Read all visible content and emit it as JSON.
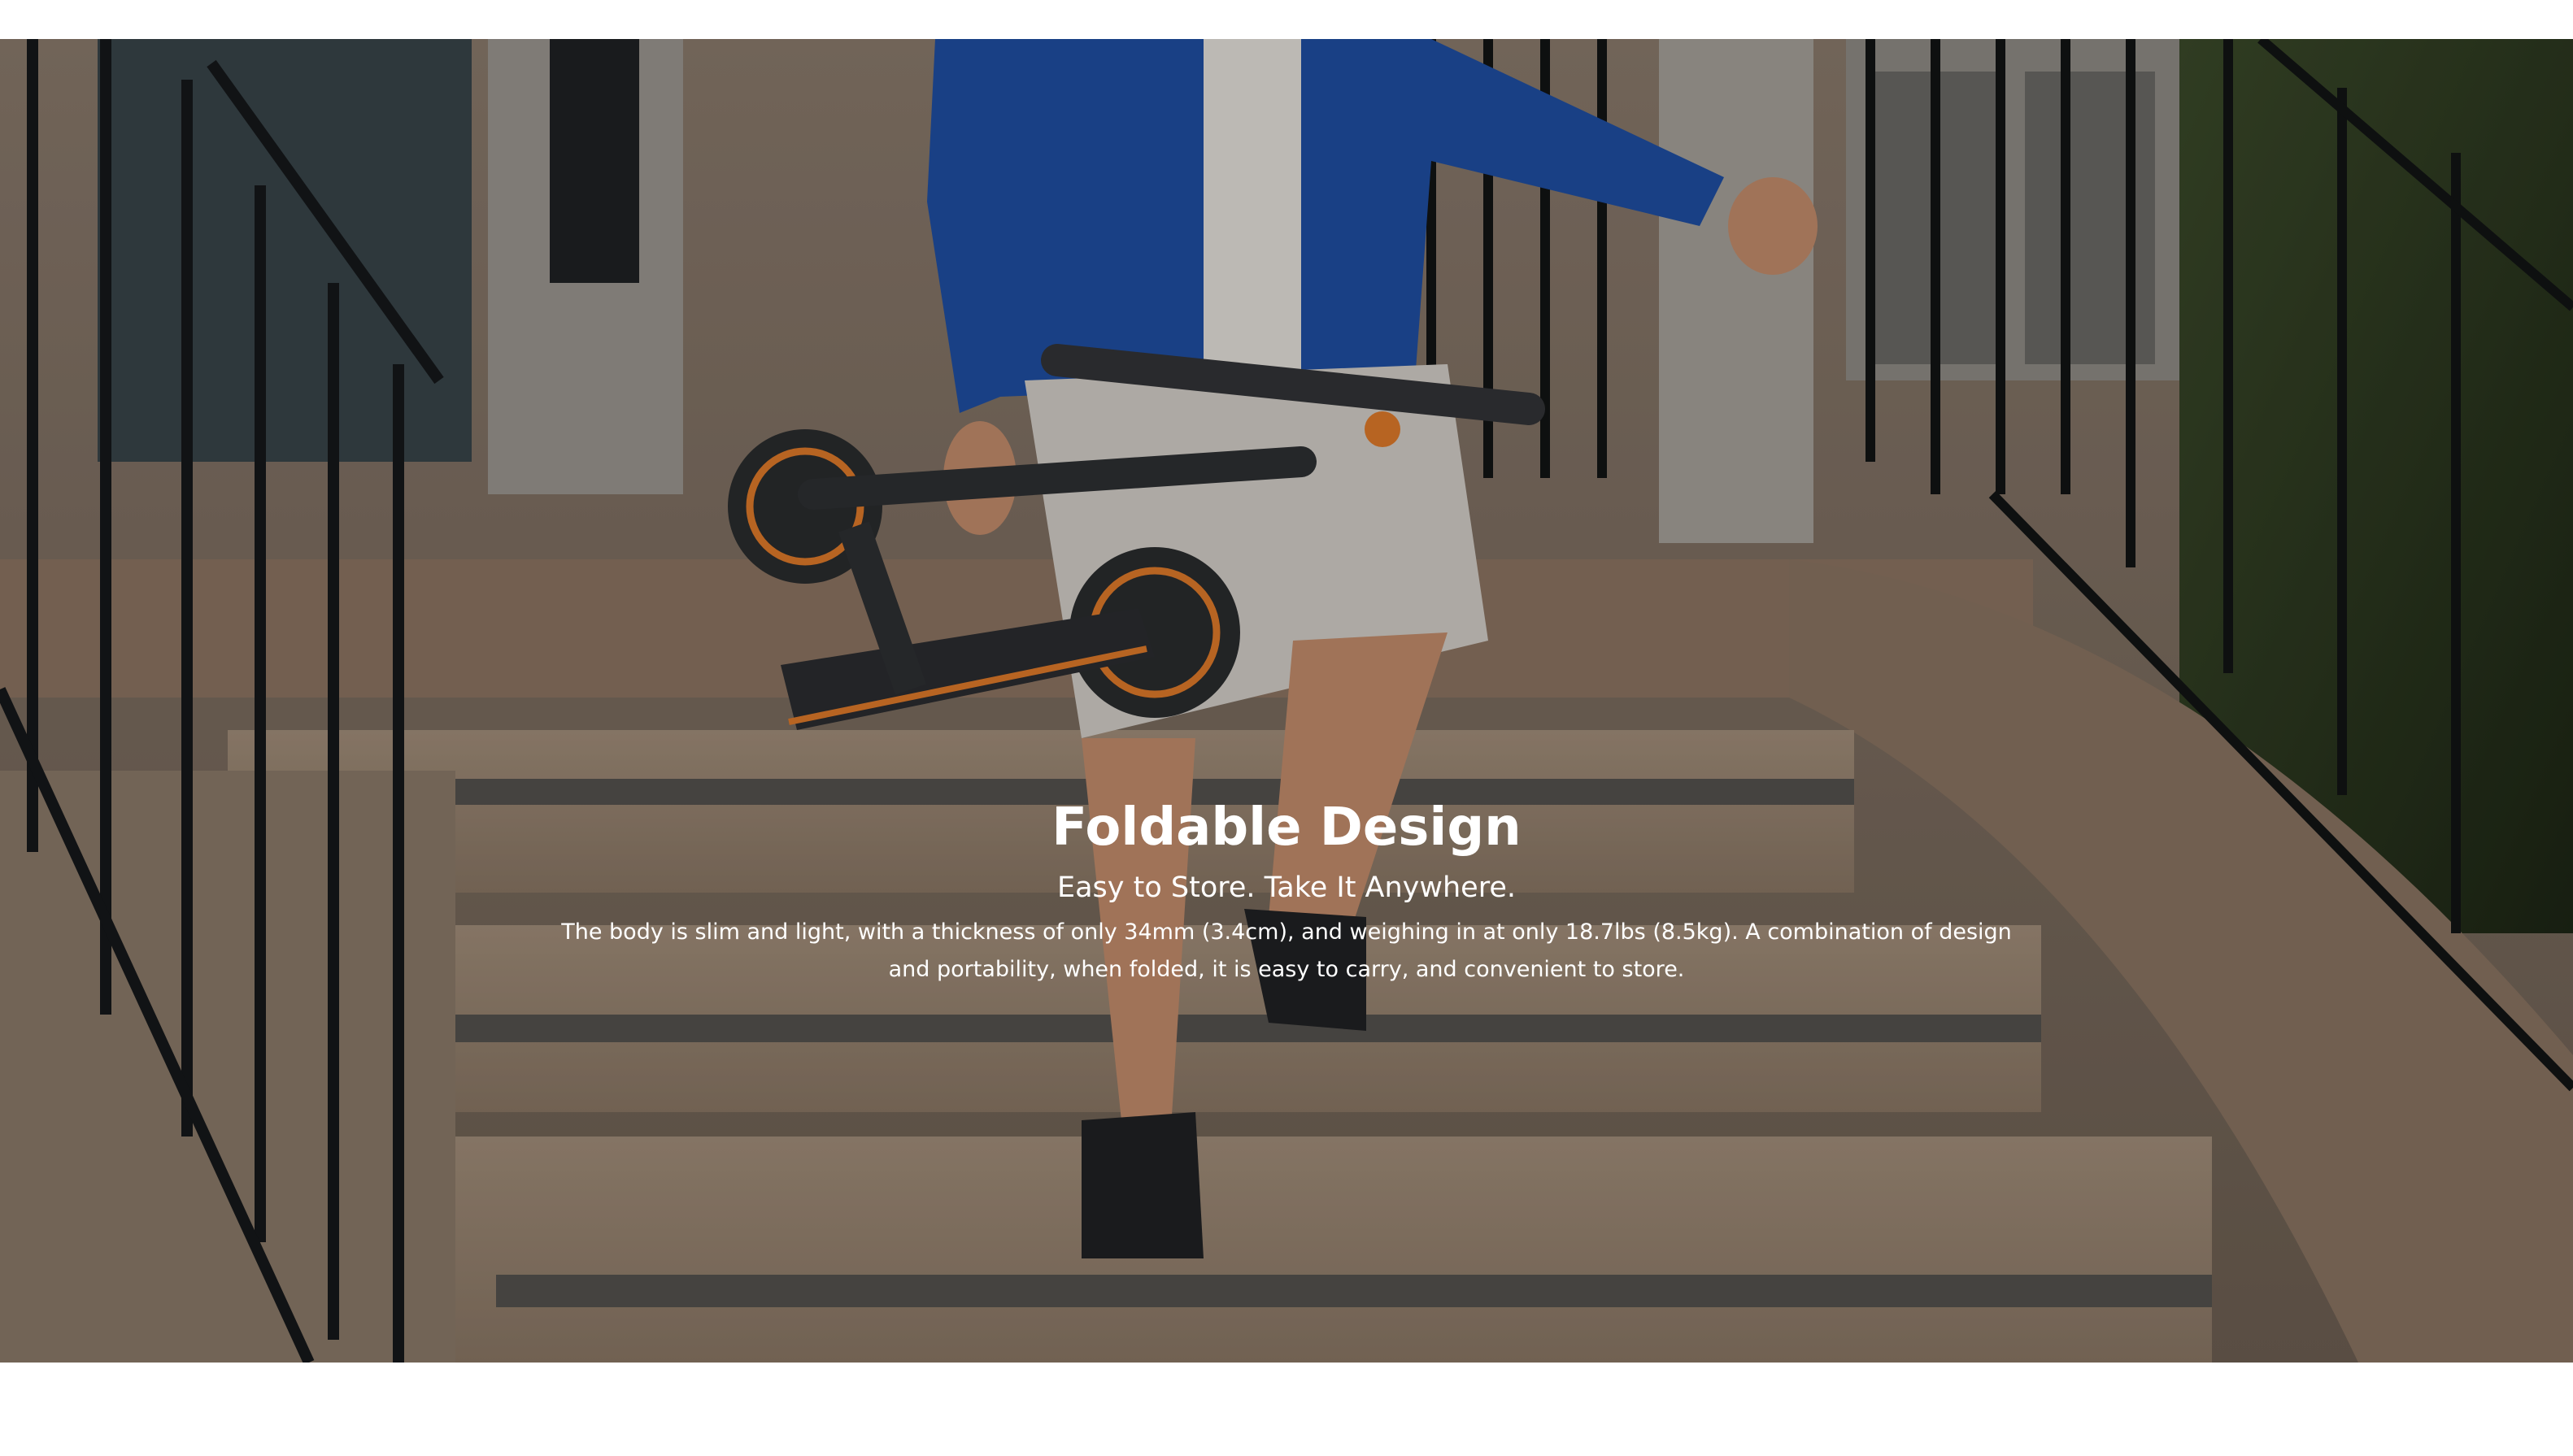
{
  "hero": {
    "headline": "Foldable Design",
    "subheadline": "Easy to Store. Take It Anywhere.",
    "body": "The body is slim and light, with a thickness of only 34mm (3.4cm), and weighing in at only 18.7lbs (8.5kg). A combination of design and portability, when folded, it is easy to carry, and convenient to store.",
    "image_description": "Person in a blue jacket carrying a folded electric scooter down outdoor brick steps",
    "colors": {
      "text": "#ffffff",
      "jacket": "#1f4fa3",
      "scooter_accent": "#e07a2a",
      "page_background": "#ffffff"
    }
  }
}
